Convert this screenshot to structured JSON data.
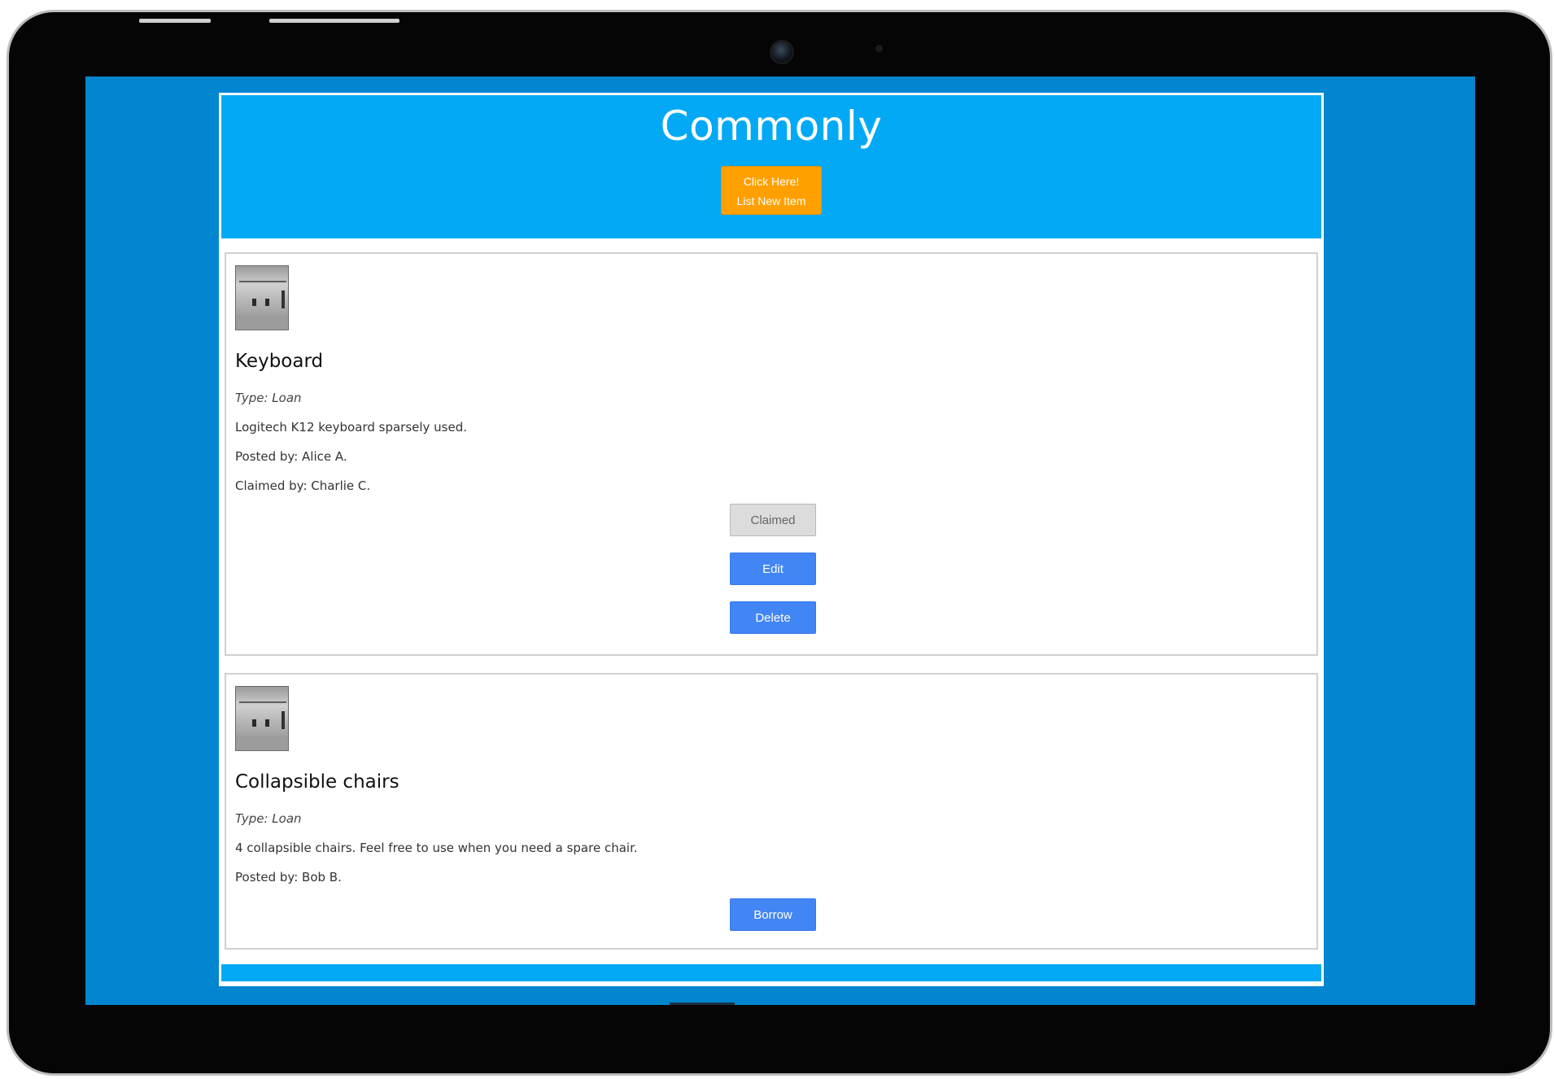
{
  "app": {
    "title": "Commonly",
    "list_button_line1": "Click Here!",
    "list_button_line2": "List New Item"
  },
  "items": [
    {
      "title": "Keyboard",
      "type": "Type: Loan",
      "description": "Logitech K12 keyboard sparsely used.",
      "posted_by": "Posted by: Alice A.",
      "claimed_by": "Claimed by: Charlie C.",
      "buttons": {
        "claimed": "Claimed",
        "edit": "Edit",
        "delete": "Delete"
      }
    },
    {
      "title": "Collapsible chairs",
      "type": "Type: Loan",
      "description": "4 collapsible chairs. Feel free to use when you need a spare chair.",
      "posted_by": "Posted by: Bob B.",
      "buttons": {
        "borrow": "Borrow"
      }
    }
  ],
  "colors": {
    "screen_background": "#0286d0",
    "header": "#03a9f4",
    "list_button": "#ffa000",
    "action_button": "#4285f4",
    "claimed_button": "#dcdcdc"
  },
  "icons": {
    "item_thumbnail": "photo-thumbnail"
  }
}
